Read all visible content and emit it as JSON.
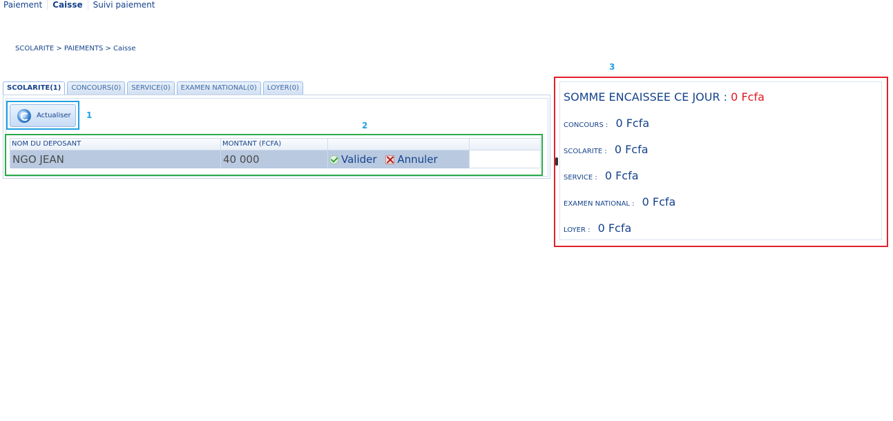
{
  "nav": {
    "paiement": "Paiement",
    "caisse": "Caisse",
    "suivi": "Suivi paiement"
  },
  "breadcrumb": "SCOLARITE > PAIEMENTS > Caisse",
  "tabs": [
    {
      "label": "SCOLARITE(1)",
      "active": true
    },
    {
      "label": "CONCOURS(0)",
      "active": false
    },
    {
      "label": "SERVICE(0)",
      "active": false
    },
    {
      "label": "EXAMEN NATIONAL(0)",
      "active": false
    },
    {
      "label": "LOYER(0)",
      "active": false
    }
  ],
  "annotations": {
    "n1": "1",
    "n2": "2",
    "n3": "3"
  },
  "toolbar": {
    "refresh_label": "Actualiser"
  },
  "grid": {
    "columns": [
      "NOM DU DEPOSANT",
      "MONTANT (FCFA)"
    ],
    "rows": [
      {
        "name": "NGO JEAN",
        "amount": "40 000",
        "validate": "Valider",
        "cancel": "Annuler"
      }
    ]
  },
  "summary": {
    "title_label": "SOMME ENCAISSEE CE JOUR :",
    "title_value": "0 Fcfa",
    "lines": [
      {
        "label": "CONCOURS :",
        "value": "0 Fcfa"
      },
      {
        "label": "SCOLARITE :",
        "value": "0 Fcfa"
      },
      {
        "label": "SERVICE :",
        "value": "0 Fcfa"
      },
      {
        "label": "EXAMEN NATIONAL :",
        "value": "0 Fcfa"
      },
      {
        "label": "LOYER :",
        "value": "0 Fcfa"
      }
    ]
  },
  "colors": {
    "accent": "#15428b",
    "total_value": "#e0161f",
    "anno1": "#1f9fe1",
    "anno2": "#2aaa4a",
    "anno3": "#e01f2a"
  }
}
